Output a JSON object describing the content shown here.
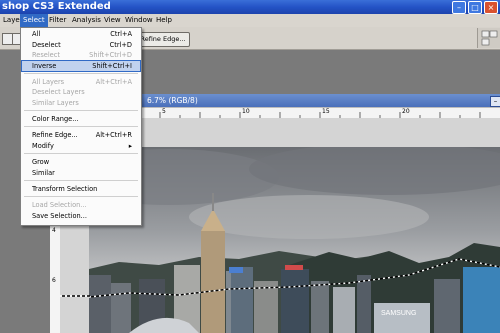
{
  "titlebar": {
    "title": "shop CS3 Extended"
  },
  "menubar": {
    "items": [
      "Layer",
      "Select",
      "Filter",
      "Analysis",
      "View",
      "Window",
      "Help"
    ],
    "active": "Select"
  },
  "options": {
    "refine_edge_label": "Refine Edge..."
  },
  "document": {
    "title": "6.7% (RGB/8)",
    "minimize_glyph": "–"
  },
  "ruler": {
    "h_ticks": [
      "0",
      "5",
      "10",
      "15",
      "20"
    ],
    "v_ticks": [
      "2",
      "4",
      "6"
    ]
  },
  "select_menu": {
    "items": [
      {
        "label": "All",
        "shortcut": "Ctrl+A",
        "enabled": true
      },
      {
        "label": "Deselect",
        "shortcut": "Ctrl+D",
        "enabled": true
      },
      {
        "label": "Reselect",
        "shortcut": "Shift+Ctrl+D",
        "enabled": false
      },
      {
        "label": "Inverse",
        "shortcut": "Shift+Ctrl+I",
        "enabled": true,
        "highlighted": true
      },
      {
        "label": "All Layers",
        "shortcut": "Alt+Ctrl+A",
        "enabled": false
      },
      {
        "label": "Deselect Layers",
        "shortcut": "",
        "enabled": false
      },
      {
        "label": "Similar Layers",
        "shortcut": "",
        "enabled": false
      },
      {
        "label": "Color Range...",
        "shortcut": "",
        "enabled": true
      },
      {
        "label": "Refine Edge...",
        "shortcut": "Alt+Ctrl+R",
        "enabled": true
      },
      {
        "label": "Modify",
        "shortcut": "▸",
        "enabled": true
      },
      {
        "label": "Grow",
        "shortcut": "",
        "enabled": true
      },
      {
        "label": "Similar",
        "shortcut": "",
        "enabled": true
      },
      {
        "label": "Transform Selection",
        "shortcut": "",
        "enabled": true
      },
      {
        "label": "Load Selection...",
        "shortcut": "",
        "enabled": false
      },
      {
        "label": "Save Selection...",
        "shortcut": "",
        "enabled": true
      }
    ]
  },
  "photo_sign": "SAMSUNG",
  "colors": {
    "accent": "#316ac5",
    "titlebar": "#2453c6",
    "menu_bg": "#d9d5ce",
    "workspace": "#7a7a7a"
  }
}
